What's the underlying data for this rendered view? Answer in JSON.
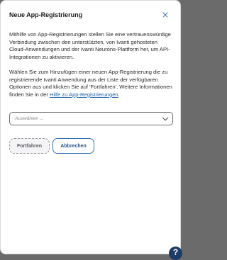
{
  "dialog": {
    "title": "Neue App-Registrierung",
    "paragraph1": "Mithilfe von App-Registrierungen stellen Sie eine vertrauenswürdige Verbindung zwischen den unterstützten, von Ivanti gehosteten Cloud-Anwendungen und der Ivanti Neurons-Plattform her, um API-Integrationen zu aktivieren.",
    "paragraph2_text": "Wählen Sie zum Hinzufügen einer neuen App-Registrierung die zu registrierende Ivanti Anwendung aus der Liste der verfügbaren Optionen aus und klicken Sie auf 'Fortfahren'. Weitere Informationen finden Sie in der ",
    "paragraph2_link": "Hilfe zu App-Registrierungen",
    "paragraph2_end": ".",
    "select_placeholder": "Auswählen ...",
    "continue_label": "Fortfahren",
    "cancel_label": "Abbrechen"
  },
  "help_button": {
    "label": "?"
  },
  "icons": {
    "close": "close-icon",
    "dropdown": "chevron-down-icon"
  },
  "colors": {
    "link": "#1f62a8",
    "cancel_border": "#2f6fb3",
    "help_bg": "#1c3b67"
  }
}
